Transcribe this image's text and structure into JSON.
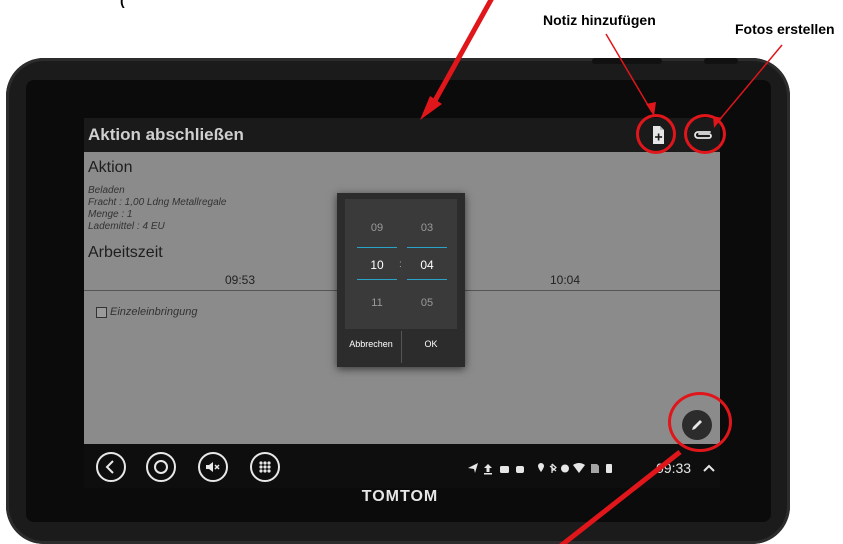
{
  "annotations": {
    "top_cut": "(",
    "note": "Notiz hinzufügen",
    "photos": "Fotos erstellen"
  },
  "device": {
    "brand": "TOMTOM"
  },
  "screen": {
    "title": "Aktion abschließen",
    "section_action": "Aktion",
    "action_lines": [
      "Beladen",
      "Fracht : 1,00 Ldng Metallregale",
      "Menge : 1",
      "Lademittel : 4 EU"
    ],
    "section_worktime": "Arbeitszeit",
    "time_start": "09:53",
    "time_end": "10:04",
    "checkbox_label": "Einzeleinbringung"
  },
  "time_picker": {
    "hours": [
      "09",
      "10",
      "11"
    ],
    "minutes": [
      "03",
      "04",
      "05"
    ],
    "colon": ":",
    "cancel": "Abbrechen",
    "ok": "OK"
  },
  "statusbar": {
    "time": "09:33"
  },
  "colors": {
    "annotation_red": "#e0161a",
    "accent": "#2aa3c9"
  }
}
